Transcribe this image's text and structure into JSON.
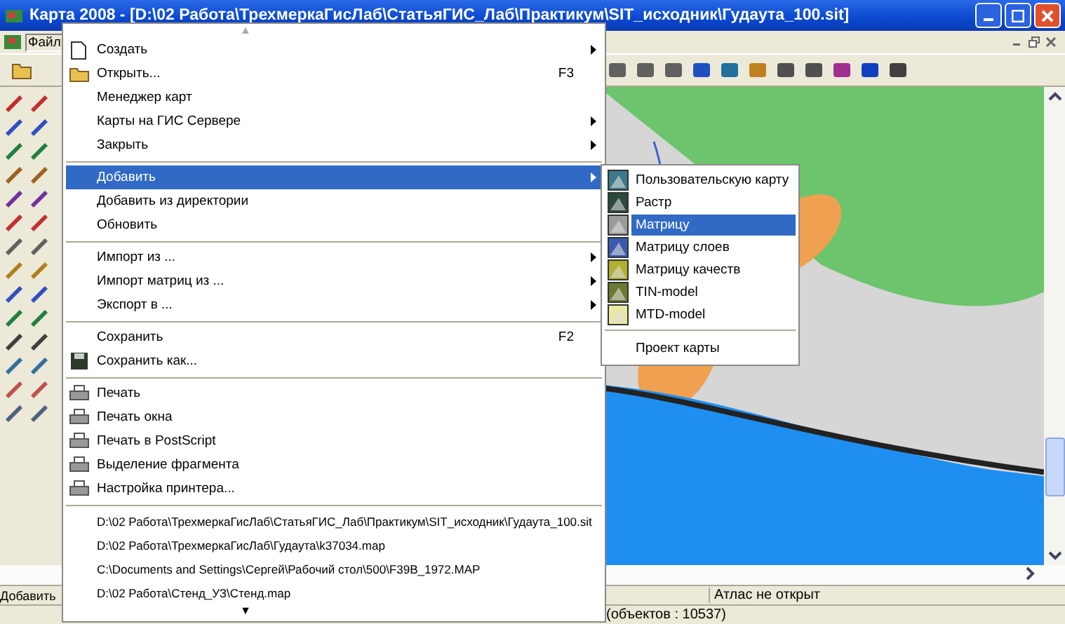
{
  "window": {
    "title": "Карта 2008 - [D:\\02 Работа\\ТрехмеркаГисЛаб\\СтатьяГИС_Лаб\\Практикум\\SIT_исходник\\Гудаута_100.sit]"
  },
  "menubar": [
    {
      "label": "Файл",
      "selected": true
    }
  ],
  "file_menu": {
    "scroll_up": "▲",
    "scroll_down": "▼",
    "items": [
      {
        "kind": "item",
        "label": "Создать",
        "submenu": true,
        "selected": false
      },
      {
        "kind": "item",
        "label": "Открыть...",
        "shortcut": "F3",
        "submenu": false,
        "selected": false
      },
      {
        "kind": "item",
        "label": "Менеджер карт",
        "submenu": false,
        "selected": false
      },
      {
        "kind": "item",
        "label": "Карты на ГИС Сервере",
        "submenu": true,
        "selected": false
      },
      {
        "kind": "item",
        "label": "Закрыть",
        "submenu": true,
        "selected": false
      },
      {
        "kind": "separator"
      },
      {
        "kind": "item",
        "label": "Добавить",
        "submenu": true,
        "selected": true
      },
      {
        "kind": "item",
        "label": "Добавить из директории",
        "submenu": false,
        "selected": false
      },
      {
        "kind": "item",
        "label": "Обновить",
        "submenu": false,
        "selected": false
      },
      {
        "kind": "separator"
      },
      {
        "kind": "item",
        "label": "Импорт из ...",
        "submenu": true,
        "selected": false
      },
      {
        "kind": "item",
        "label": "Импорт матриц из ...",
        "submenu": true,
        "selected": false
      },
      {
        "kind": "item",
        "label": "Экспорт в ...",
        "submenu": true,
        "selected": false
      },
      {
        "kind": "separator"
      },
      {
        "kind": "item",
        "label": "Сохранить",
        "shortcut": "F2",
        "submenu": false,
        "selected": false
      },
      {
        "kind": "item",
        "label": "Сохранить как...",
        "submenu": false,
        "selected": false
      },
      {
        "kind": "separator"
      },
      {
        "kind": "item",
        "label": "Печать",
        "submenu": false,
        "selected": false
      },
      {
        "kind": "item",
        "label": "Печать окна",
        "submenu": false,
        "selected": false
      },
      {
        "kind": "item",
        "label": "Печать в PostScript",
        "submenu": false,
        "selected": false
      },
      {
        "kind": "item",
        "label": "Выделение фрагмента",
        "submenu": false,
        "selected": false
      },
      {
        "kind": "item",
        "label": "Настройка принтера...",
        "submenu": false,
        "selected": false
      },
      {
        "kind": "separator"
      },
      {
        "kind": "item",
        "label": "D:\\02 Работа\\ТрехмеркаГисЛаб\\СтатьяГИС_Лаб\\Практикум\\SIT_исходник\\Гудаута_100.sit",
        "submenu": false,
        "selected": false
      },
      {
        "kind": "item",
        "label": "D:\\02 Работа\\ТрехмеркаГисЛаб\\Гудаута\\k37034.map",
        "submenu": false,
        "selected": false
      },
      {
        "kind": "item",
        "label": "C:\\Documents and Settings\\Сергей\\Рабочий стол\\500\\F39B_1972.MAP",
        "submenu": false,
        "selected": false
      },
      {
        "kind": "item",
        "label": "D:\\02 Работа\\Стенд_УЗ\\Стенд.map",
        "submenu": false,
        "selected": false
      }
    ]
  },
  "add_submenu": {
    "items": [
      {
        "kind": "item",
        "label": "Пользовательскую карту",
        "selected": false
      },
      {
        "kind": "item",
        "label": "Растр",
        "selected": false
      },
      {
        "kind": "item",
        "label": "Матрицу",
        "selected": true
      },
      {
        "kind": "item",
        "label": "Матрицу слоев",
        "selected": false
      },
      {
        "kind": "item",
        "label": "Матрицу качеств",
        "selected": false
      },
      {
        "kind": "item",
        "label": "TIN-model",
        "selected": false
      },
      {
        "kind": "item",
        "label": "MTD-model",
        "selected": false
      },
      {
        "kind": "separator"
      },
      {
        "kind": "item",
        "label": "Проект карты",
        "selected": false
      }
    ]
  },
  "status_bar": {
    "hint": "Добавить",
    "atlas": "Атлас не открыт",
    "objects": "(объектов : 10537)"
  }
}
